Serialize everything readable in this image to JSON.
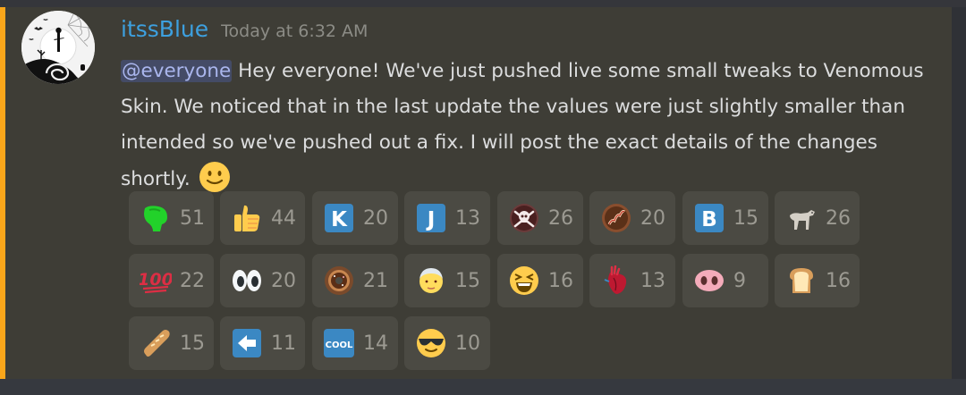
{
  "message": {
    "author": "itssBlue",
    "timestamp": "Today at 6:32 AM",
    "mention": "@everyone",
    "text": " Hey everyone! We've just pushed live some small tweaks to Venomous Skin. We noticed that in the last update the values were just slightly smaller than intended so we've pushed out a fix. I will post the exact details of the changes shortly.",
    "inline_emoji": "slightly-smiling-face",
    "avatar": "nightmare-before-christmas-avatar"
  },
  "colors": {
    "mention_bar": "#faa61a",
    "username": "#3da0df",
    "reaction_bg": "#4b4a43",
    "message_bg": "#3e3d36"
  },
  "reactions": [
    {
      "emoji": "green-blob-icon",
      "count": "51"
    },
    {
      "emoji": "thumbs-up-icon",
      "count": "44"
    },
    {
      "emoji": "letter-k-icon",
      "count": "20"
    },
    {
      "emoji": "letter-j-icon",
      "count": "13"
    },
    {
      "emoji": "skull-crossbones-icon",
      "count": "26"
    },
    {
      "emoji": "bacon-icon",
      "count": "20"
    },
    {
      "emoji": "letter-b-icon",
      "count": "15"
    },
    {
      "emoji": "dog-icon",
      "count": "26"
    },
    {
      "emoji": "hundred-points-icon",
      "count": "22"
    },
    {
      "emoji": "eyes-icon",
      "count": "20"
    },
    {
      "emoji": "donut-icon",
      "count": "21"
    },
    {
      "emoji": "old-man-icon",
      "count": "15"
    },
    {
      "emoji": "laughing-face-icon",
      "count": "16"
    },
    {
      "emoji": "anatomical-heart-icon",
      "count": "13"
    },
    {
      "emoji": "pig-nose-icon",
      "count": "9"
    },
    {
      "emoji": "bread-icon",
      "count": "16"
    },
    {
      "emoji": "baguette-icon",
      "count": "15"
    },
    {
      "emoji": "left-arrow-icon",
      "count": "11"
    },
    {
      "emoji": "cool-button-icon",
      "count": "14"
    },
    {
      "emoji": "sunglasses-face-icon",
      "count": "10"
    }
  ],
  "reaction_labels": {
    "letter_k": "K",
    "letter_j": "J",
    "letter_b": "B",
    "hundred": "100",
    "cool": "COOL"
  }
}
